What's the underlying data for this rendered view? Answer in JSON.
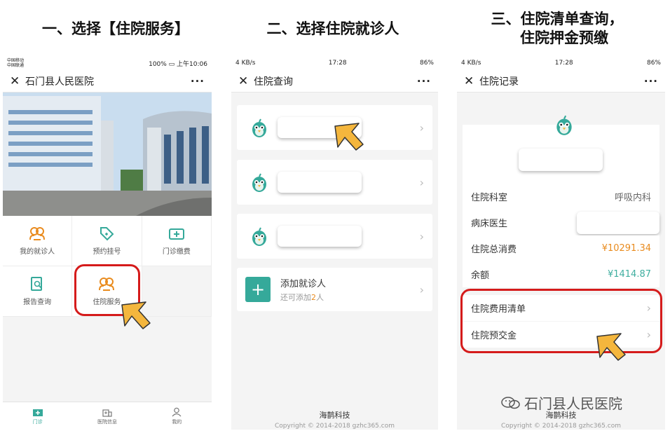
{
  "steps": {
    "s1": "一、选择【住院服务】",
    "s2": "二、选择住院就诊人",
    "s3_line1": "三、住院清单查询，",
    "s3_line2": "住院押金预缴"
  },
  "phone1": {
    "status_left": "中国移动",
    "status_left2": "中国联通",
    "status_right": "100% ▭ 上午10:06",
    "title": "石门县人民医院",
    "grid": [
      {
        "label": "我的就诊人",
        "icon": "users-icon"
      },
      {
        "label": "预约挂号",
        "icon": "tag-icon"
      },
      {
        "label": "门诊缴费",
        "icon": "payment-icon"
      },
      {
        "label": "报告查询",
        "icon": "report-icon"
      },
      {
        "label": "住院服务",
        "icon": "users-icon"
      }
    ],
    "tabs": [
      {
        "label": "门诊",
        "icon": "clinic-icon"
      },
      {
        "label": "医院信息",
        "icon": "hospital-icon"
      },
      {
        "label": "我的",
        "icon": "profile-icon"
      }
    ]
  },
  "phone2": {
    "status_left": "4 KB/s",
    "status_time": "17:28",
    "status_right": "86%",
    "title": "住院查询",
    "add_label": "添加就诊人",
    "add_sub_prefix": "还可添加",
    "add_sub_count": "2",
    "add_sub_suffix": "人",
    "brand": "海鹊科技",
    "copyright": "Copyright © 2014-2018 gzhc365.com"
  },
  "phone3": {
    "status_left": "4 KB/s",
    "status_time": "17:28",
    "status_right": "86%",
    "title": "住院记录",
    "rows": [
      {
        "label": "住院科室",
        "value": "呼吸内科"
      },
      {
        "label": "病床医生",
        "value": ""
      },
      {
        "label": "住院总消费",
        "value": "¥10291.34"
      },
      {
        "label": "余额",
        "value": "¥1414.87"
      }
    ],
    "links": [
      {
        "label": "住院费用清单"
      },
      {
        "label": "住院预交金"
      }
    ],
    "brand": "海鹊科技",
    "copyright": "Copyright © 2014-2018 gzhc365.com",
    "watermark": "石门县人民医院"
  },
  "colors": {
    "accent": "#35a99a",
    "orange": "#e98b1e",
    "highlight": "#d51b1b",
    "arrow": "#f4b63d"
  }
}
